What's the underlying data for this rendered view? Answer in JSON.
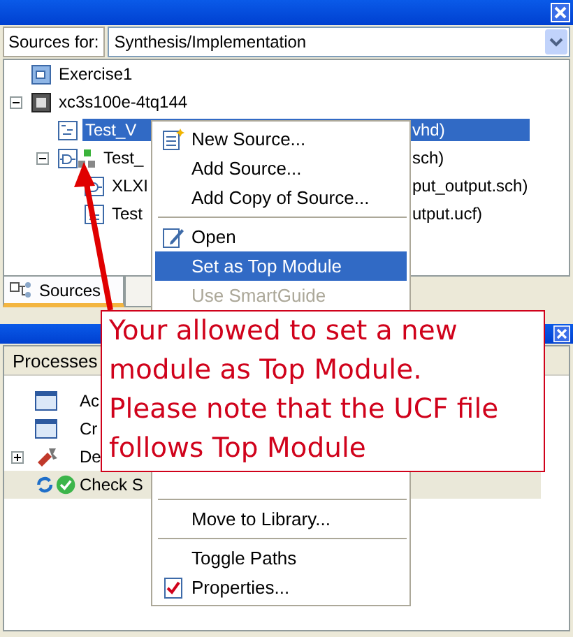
{
  "sources_panel": {
    "sources_for_label": "Sources for:",
    "sources_for_value": "Synthesis/Implementation",
    "tree": [
      {
        "kind": "project",
        "label": "Exercise1",
        "selected": false
      },
      {
        "kind": "chip",
        "label": "xc3s100e-4tq144",
        "selected": false,
        "expanded": true,
        "children": [
          {
            "kind": "vhdl",
            "label": "Test_V",
            "tail": "vhd)",
            "selected": true
          },
          {
            "kind": "schematic",
            "label": "Test_",
            "tail": "sch)",
            "selected": false,
            "expanded": true,
            "children": [
              {
                "kind": "schematic-file",
                "label": "XLXI",
                "tail": "put_output.sch)",
                "selected": false
              },
              {
                "kind": "ucf",
                "label": "Test",
                "tail": "utput.ucf)",
                "selected": false
              }
            ]
          }
        ]
      }
    ],
    "tabs": [
      {
        "label": "Sources",
        "selected": true
      },
      {
        "selected": false
      }
    ]
  },
  "processes_panel": {
    "header": "Processes",
    "rows": [
      {
        "kind": "window",
        "label": "Ac",
        "selected": false
      },
      {
        "kind": "window",
        "label": "Cr",
        "selected": false
      },
      {
        "kind": "tools",
        "label": "De",
        "selected": false,
        "expanded": false
      },
      {
        "kind": "check",
        "label": "Check S",
        "selected": true
      }
    ]
  },
  "context_menu": {
    "items": [
      {
        "kind": "new-item",
        "label": "New Source...",
        "selected": false,
        "disabled": false
      },
      {
        "kind": "item",
        "label": "Add Source...",
        "selected": false,
        "disabled": false
      },
      {
        "kind": "item",
        "label": "Add Copy of Source...",
        "selected": false,
        "disabled": false
      },
      {
        "kind": "separator"
      },
      {
        "kind": "open-item",
        "label": "Open",
        "selected": false,
        "disabled": false
      },
      {
        "kind": "item",
        "label": "Set as Top Module",
        "selected": true,
        "disabled": false
      },
      {
        "kind": "item",
        "label": "Use SmartGuide",
        "selected": false,
        "disabled": true
      }
    ],
    "lower_items": [
      {
        "kind": "separator"
      },
      {
        "kind": "item",
        "label": "Move to Library...",
        "selected": false,
        "disabled": false
      },
      {
        "kind": "separator"
      },
      {
        "kind": "item",
        "label": "Toggle Paths",
        "selected": false,
        "disabled": false
      },
      {
        "kind": "properties-item",
        "label": "Properties...",
        "selected": false,
        "disabled": false
      }
    ]
  },
  "callout": {
    "lines": [
      "Your allowed to set a new",
      "module as Top Module.",
      "Please note that the UCF file",
      "follows Top Module"
    ]
  }
}
